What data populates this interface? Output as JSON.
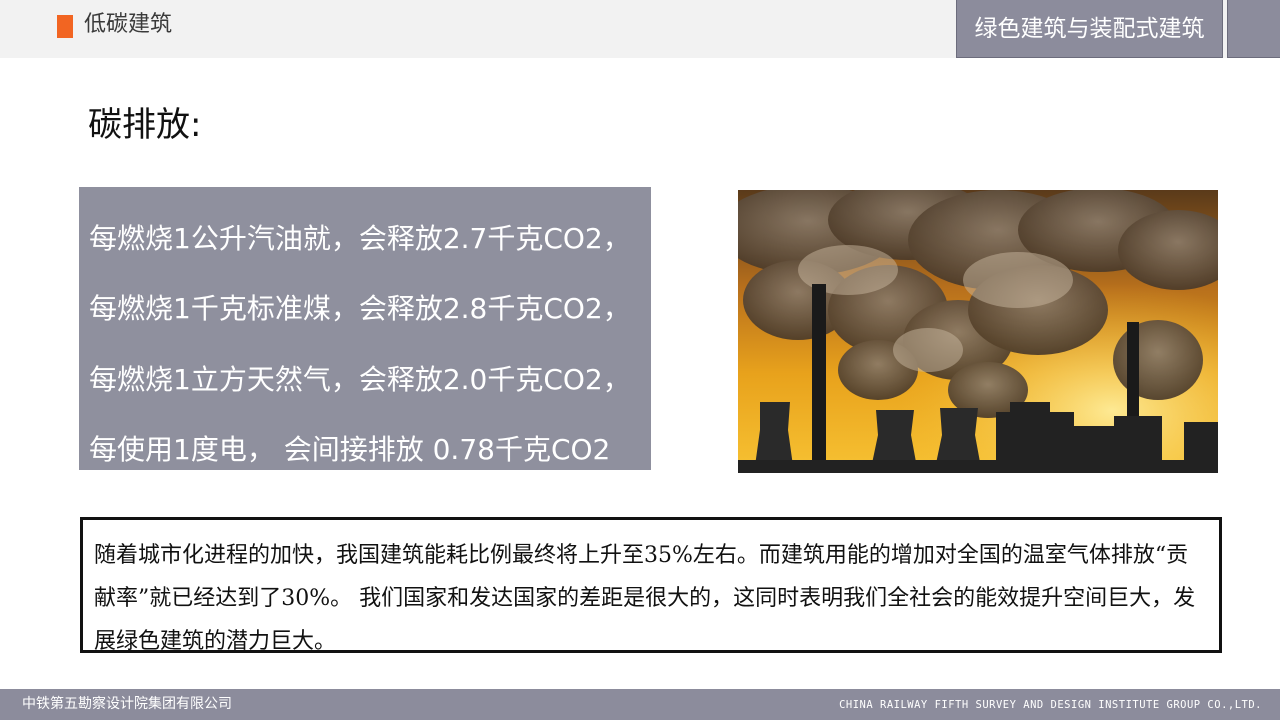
{
  "header": {
    "title": "低碳建筑",
    "tag": "绿色建筑与装配式建筑",
    "accent_color": "#f26522"
  },
  "section": {
    "title": "碳排放:"
  },
  "facts": [
    "每燃烧1公升汽油就，会释放2.7千克CO2，",
    "每燃烧1千克标准煤，会释放2.8千克CO2，",
    "每燃烧1立方天然气，会释放2.0千克CO2，",
    "每使用1度电， 会间接排放  0.78千克CO2"
  ],
  "image": {
    "subject": "power-plant-smokestacks"
  },
  "note": {
    "text": "随着城市化进程的加快，我国建筑能耗比例最终将上升至35%左右。而建筑用能的增加对全国的温室气体排放“贡献率”就已经达到了30%。 我们国家和发达国家的差距是很大的，这同时表明我们全社会的能效提升空间巨大，发展绿色建筑的潜力巨大。"
  },
  "footer": {
    "left": "中铁第五勘察设计院集团有限公司",
    "right": "CHINA RAILWAY FIFTH SURVEY AND DESIGN INSTITUTE GROUP CO.,LTD."
  },
  "colors": {
    "panel": "#8f909e",
    "bar": "#8c8c9c"
  }
}
